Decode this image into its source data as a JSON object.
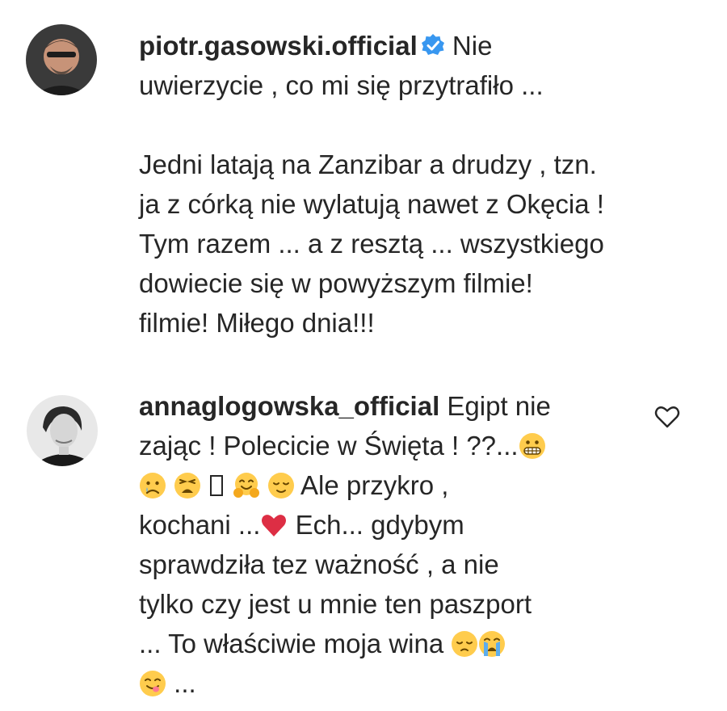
{
  "comments": [
    {
      "username": "piotr.gasowski.official",
      "verified": true,
      "lines": [
        "Nie",
        "uwierzycie , co mi się przytrafiło ...",
        "",
        "Jedni latają na Zanzibar a drudzy , tzn.",
        "ja z córką nie wylatują nawet z Okęcia !",
        "Tym razem ... a z resztą ... wszystkiego",
        "dowiecie się w powyższym filmie!",
        "filmie! Miłego dnia!!!"
      ]
    },
    {
      "username": "annaglogowska_official",
      "verified": false,
      "lines": [
        "Egipt nie",
        "zając ! Polecicie w Święta ! ??...",
        "Ale przykro ,",
        "kochani ...",
        "Ech... gdybym",
        "sprawdziła tez ważność , a nie",
        "tylko czy jest u mnie ten paszport",
        "... To właściwie moja wina",
        "..."
      ],
      "emoji": {
        "grimace": "grimacing-face-emoji",
        "sad": "sad-face-emoji",
        "weary": "weary-face-emoji",
        "hug": "hugging-face-emoji",
        "relieved": "relieved-face-emoji",
        "heart": "red-heart-emoji",
        "pensive": "pensive-face-emoji",
        "crying": "loudly-crying-face-emoji",
        "yum": "savoring-face-emoji"
      }
    }
  ],
  "colors": {
    "text": "#262626",
    "verified_badge": "#3897f0",
    "emoji_yellow": "#ffcc4d",
    "heart_red": "#dd2e44"
  }
}
